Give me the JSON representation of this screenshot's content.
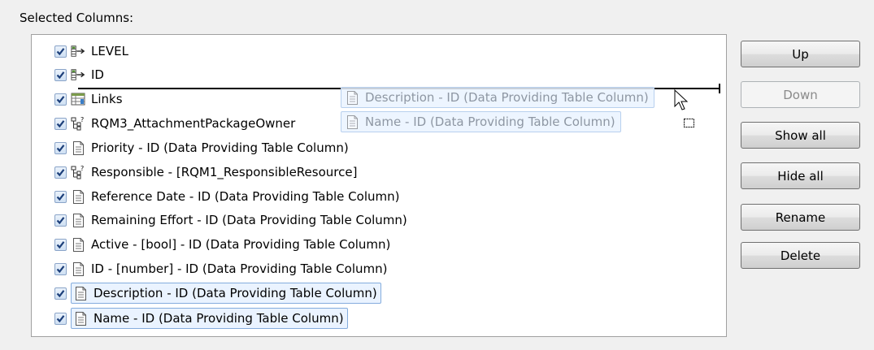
{
  "section_label": "Selected Columns:",
  "columns": [
    {
      "label": "LEVEL",
      "icon": "level-column-icon",
      "checked": true
    },
    {
      "label": "ID",
      "icon": "level-column-icon",
      "checked": true
    },
    {
      "label": "Links",
      "icon": "table-links-icon",
      "checked": true
    },
    {
      "label": "RQM3_AttachmentPackageOwner",
      "icon": "tree-unknown-icon",
      "checked": true
    },
    {
      "label": "Priority - ID (Data Providing Table Column)",
      "icon": "document-icon",
      "checked": true
    },
    {
      "label": "Responsible - [RQM1_ResponsibleResource]",
      "icon": "tree-unknown-icon",
      "checked": true
    },
    {
      "label": "Reference Date - ID (Data Providing Table Column)",
      "icon": "document-icon",
      "checked": true
    },
    {
      "label": "Remaining Effort - ID (Data Providing Table Column)",
      "icon": "document-icon",
      "checked": true
    },
    {
      "label": "Active - [bool] - ID (Data Providing Table Column)",
      "icon": "document-icon",
      "checked": true
    },
    {
      "label": "ID - [number] - ID (Data Providing Table Column)",
      "icon": "document-icon",
      "checked": true
    },
    {
      "label": "Description - ID (Data Providing Table Column)",
      "icon": "document-icon",
      "checked": true,
      "selected": true
    },
    {
      "label": "Name - ID (Data Providing Table Column)",
      "icon": "document-icon",
      "checked": true,
      "selected": true
    }
  ],
  "drag_preview": [
    "Description - ID (Data Providing Table Column)",
    "Name - ID (Data Providing Table Column)"
  ],
  "buttons": {
    "up": "Up",
    "down": "Down",
    "show_all": "Show all",
    "hide_all": "Hide all",
    "rename": "Rename",
    "delete": "Delete"
  },
  "colors": {
    "selection_fill": "#eaf3ff",
    "selection_border": "#84acdd",
    "checkmark": "#1c3f7a"
  }
}
